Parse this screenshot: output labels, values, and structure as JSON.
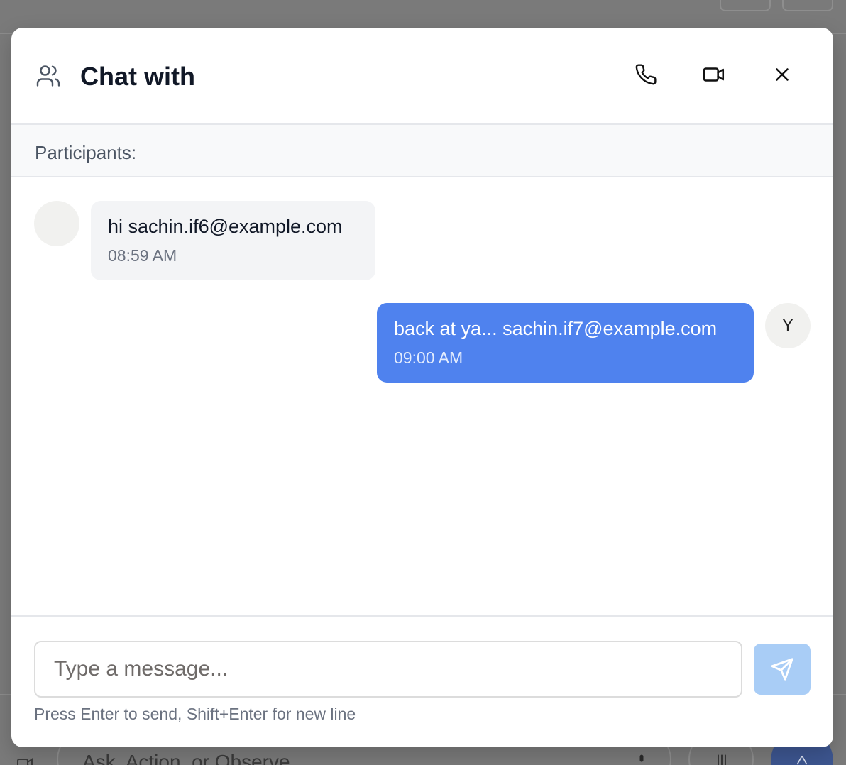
{
  "background": {
    "ask_placeholder": "Ask, Action, or Observe"
  },
  "modal": {
    "title": "Chat with",
    "participants_label": "Participants:",
    "header_icons": [
      "users-icon",
      "phone-icon",
      "video-icon",
      "close-icon"
    ]
  },
  "messages": [
    {
      "sender": "other",
      "avatar_initial": "",
      "text": "hi sachin.if6@example.com",
      "time": "08:59 AM"
    },
    {
      "sender": "self",
      "avatar_initial": "Y",
      "text": "back at ya... sachin.if7@example.com",
      "time": "09:00 AM"
    }
  ],
  "composer": {
    "placeholder": "Type a message...",
    "value": "",
    "hint": "Press Enter to send, Shift+Enter for new line",
    "send_icon": "send-icon"
  },
  "colors": {
    "self_bubble": "#4f82ee",
    "other_bubble": "#f3f4f6",
    "send_button_disabled": "#a9cdf6",
    "overlay": "#7a7a7a"
  }
}
